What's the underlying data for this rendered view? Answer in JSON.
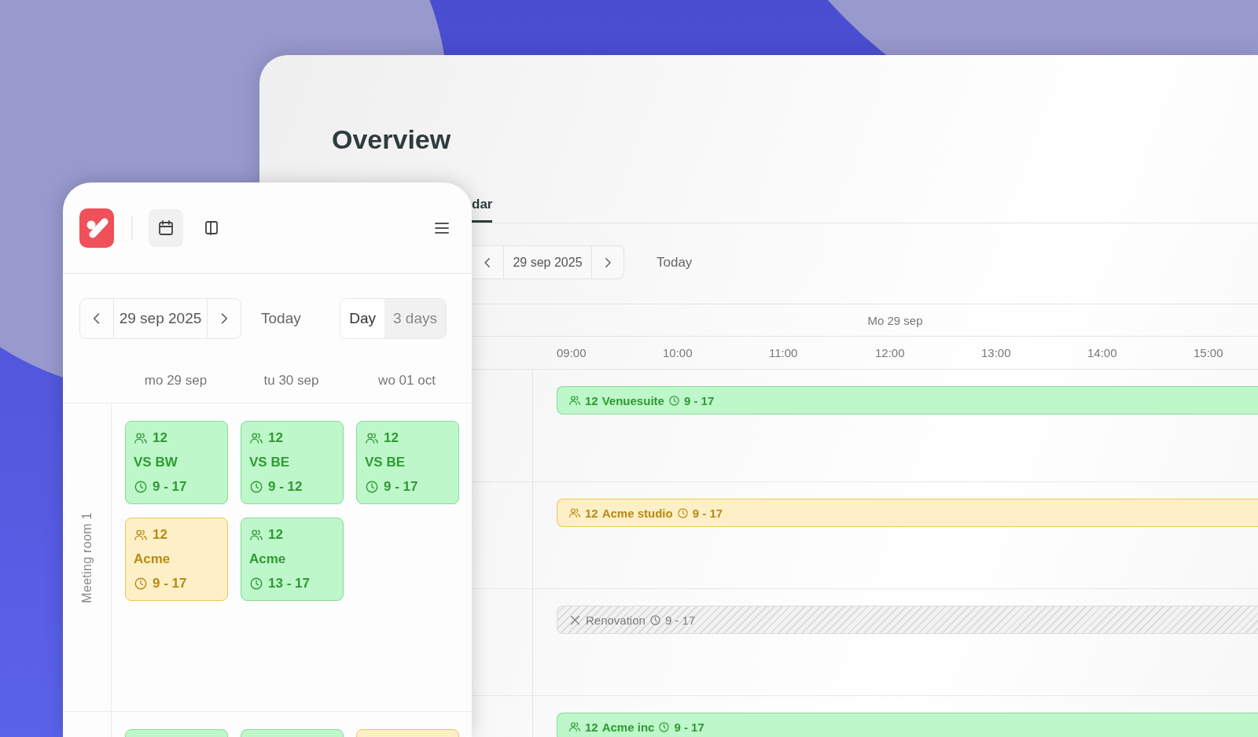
{
  "overview": {
    "title": "Overview",
    "tabs": [
      {
        "label": "dar",
        "selected": true
      }
    ],
    "date": "29 sep 2025",
    "today": "Today",
    "day_header": "Mo 29 sep",
    "hours": [
      "09:00",
      "10:00",
      "11:00",
      "12:00",
      "13:00",
      "14:00",
      "15:00"
    ],
    "rows": [
      {
        "events": [
          {
            "kind": "booking",
            "color": "#bdf7ca",
            "guests": "12",
            "name": "Venuesuite",
            "time": "9 - 17"
          }
        ]
      },
      {
        "events": [
          {
            "kind": "booking",
            "color": "#fdefc6",
            "guests": "12",
            "name": "Acme studio",
            "time": "9 - 17"
          }
        ]
      },
      {
        "events": [
          {
            "kind": "blocked",
            "name": "Renovation",
            "time": "9 - 17"
          }
        ]
      },
      {
        "events": [
          {
            "kind": "booking",
            "color": "#bdf7ca",
            "guests": "12",
            "name": "Acme inc",
            "time": "9 - 17"
          }
        ]
      }
    ]
  },
  "planner": {
    "views": [
      {
        "selected": true
      },
      {
        "selected": false
      }
    ],
    "date": "29 sep 2025",
    "today": "Today",
    "ranges": [
      {
        "label": "Day",
        "selected": true
      },
      {
        "label": "3 days",
        "selected": false
      }
    ],
    "days": [
      "mo 29 sep",
      "tu 30 sep",
      "wo 01 oct"
    ],
    "rooms": [
      {
        "name": "Meeting room 1",
        "columns": [
          [
            {
              "color": "#bdf7ca",
              "guests": "12",
              "name": "VS BW",
              "time": "9 - 17"
            },
            {
              "color": "#fdefc6",
              "guests": "12",
              "name": "Acme",
              "time": "9 - 17"
            }
          ],
          [
            {
              "color": "#bdf7ca",
              "guests": "12",
              "name": "VS BE",
              "time": "9 - 12"
            },
            {
              "color": "#bdf7ca",
              "guests": "12",
              "name": "Acme",
              "time": "13 - 17"
            }
          ],
          [
            {
              "color": "#bdf7ca",
              "guests": "12",
              "name": "VS BE",
              "time": "9 - 17"
            }
          ]
        ]
      },
      {
        "columns": [
          [
            {
              "color": "#bdf7ca"
            }
          ],
          [
            {
              "color": "#bdf7ca"
            }
          ],
          [
            {
              "color": "#fdefc6"
            }
          ]
        ]
      }
    ]
  }
}
